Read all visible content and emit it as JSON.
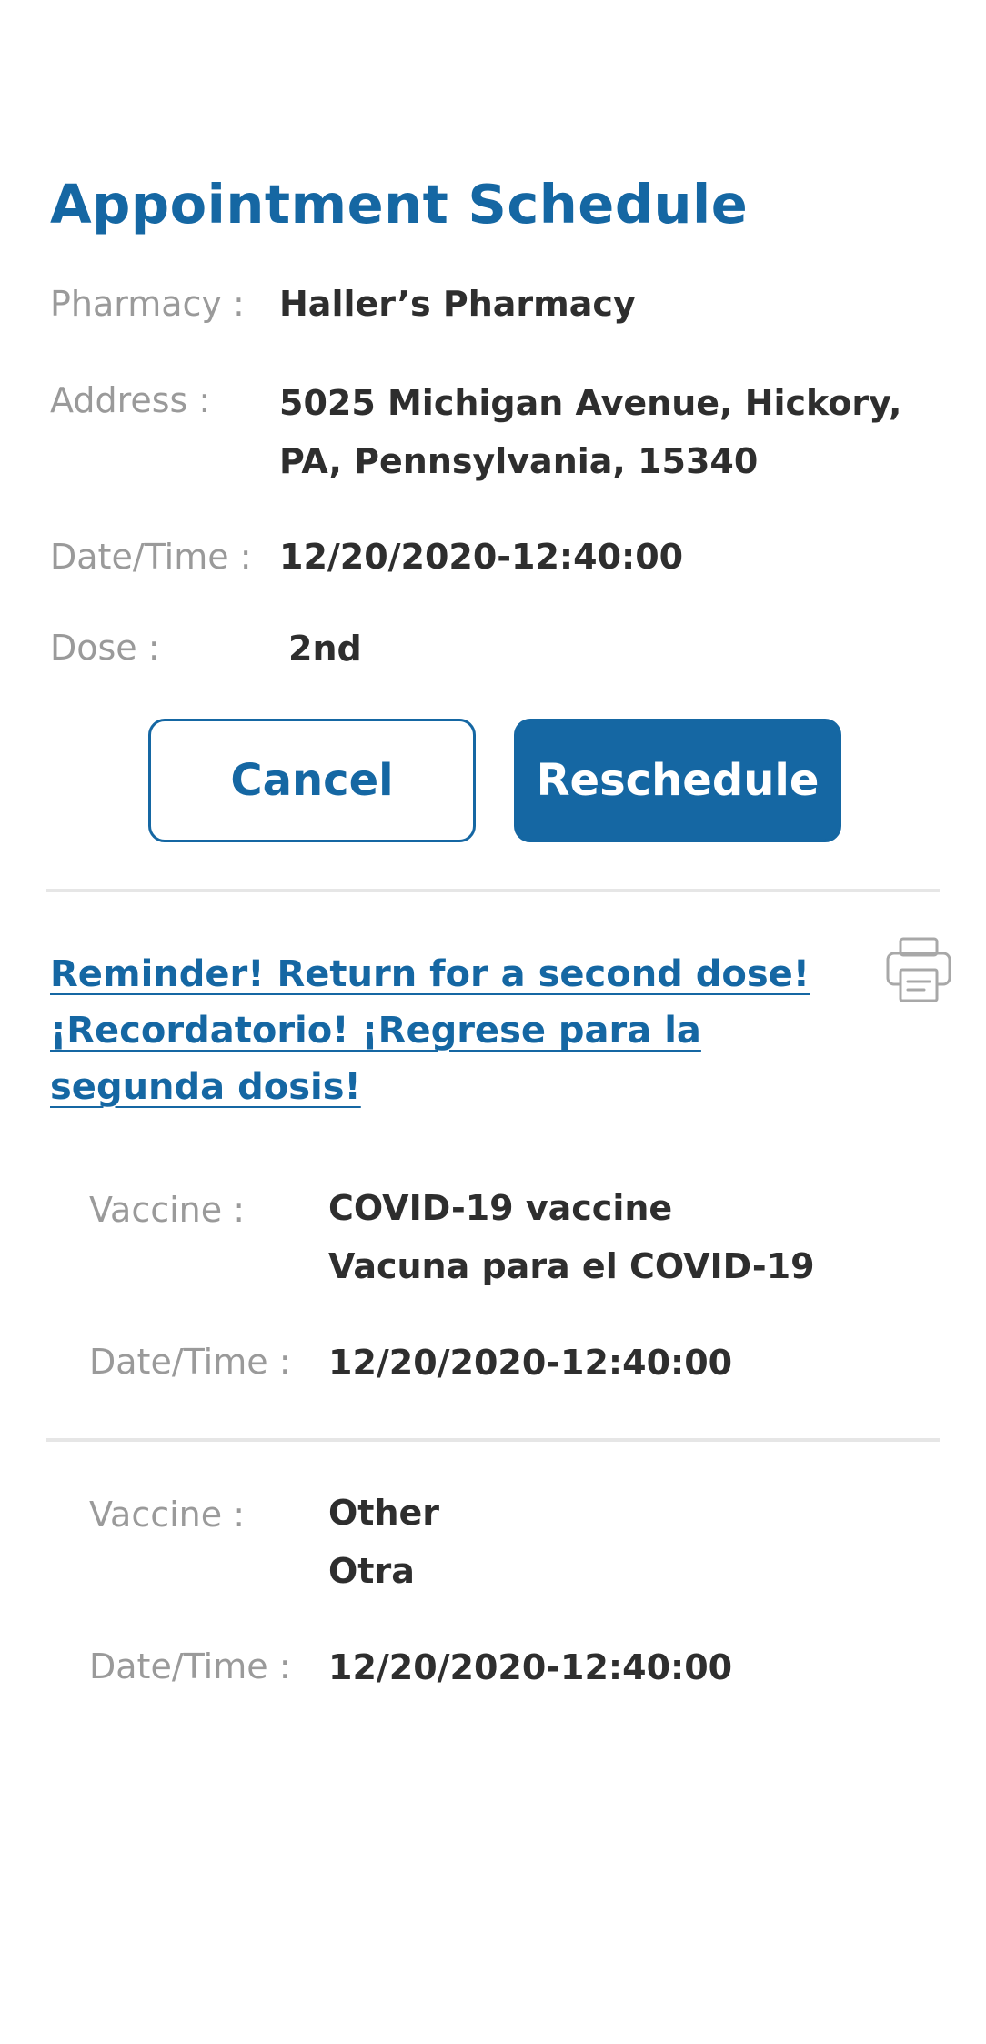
{
  "header": {
    "title": "Appointment Schedule"
  },
  "appointment": {
    "pharmacy_label": "Pharmacy :",
    "pharmacy_value": "Haller’s Pharmacy",
    "address_label": "Address :",
    "address_line1": "5025  Michigan Avenue, Hickory,",
    "address_line2": "PA, Pennsylvania, 15340",
    "datetime_label": "Date/Time :",
    "datetime_value": "12/20/2020-12:40:00",
    "dose_label": "Dose :",
    "dose_value": "2nd"
  },
  "actions": {
    "cancel_label": "Cancel",
    "reschedule_label": "Reschedule"
  },
  "reminder": {
    "line1": "Reminder! Return for a second dose!",
    "line2": "¡Recordatorio! ¡Regrese para la ",
    "line3": "segunda dosis!"
  },
  "icons": {
    "print": "print-icon"
  },
  "vaccines": [
    {
      "vaccine_label": "Vaccine :",
      "vaccine_line1": "COVID-19 vaccine",
      "vaccine_line2": "Vacuna para el COVID-19",
      "datetime_label": "Date/Time :",
      "datetime_value": "12/20/2020-12:40:00"
    },
    {
      "vaccine_label": "Vaccine :",
      "vaccine_line1": "Other",
      "vaccine_line2": "Otra",
      "datetime_label": "Date/Time :",
      "datetime_value": "12/20/2020-12:40:00"
    }
  ],
  "colors": {
    "accent": "#1567a3",
    "label": "#9a9a9a",
    "value": "#2e2e2e",
    "divider": "#e6e6e6"
  }
}
